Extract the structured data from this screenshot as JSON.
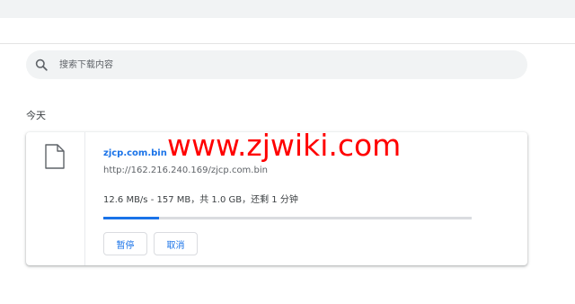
{
  "search": {
    "placeholder": "搜索下载内容",
    "icon": "search-icon"
  },
  "section": {
    "label": "今天"
  },
  "download": {
    "filename": "zjcp.com.bin",
    "url": "http://162.216.240.169/zjcp.com.bin",
    "status": "12.6 MB/s - 157 MB，共 1.0 GB，还剩 1 分钟",
    "progress_fraction": 0.15,
    "file_icon": "file-icon",
    "pause_label": "暂停",
    "cancel_label": "取消"
  },
  "watermark": {
    "text": "www.zjwiki.com"
  },
  "colors": {
    "accent": "#1a73e8",
    "watermark": "#ff0000",
    "background": "#ffffff",
    "search_bg": "#f1f3f4"
  }
}
